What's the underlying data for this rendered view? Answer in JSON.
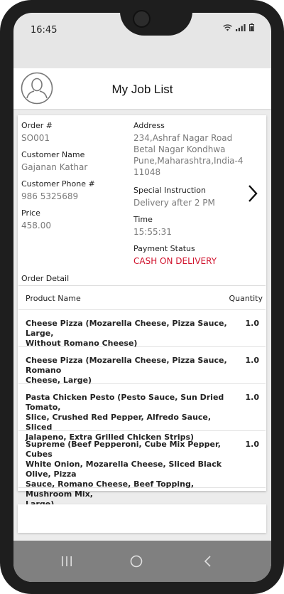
{
  "status_bar": {
    "time": "16:45",
    "icons": [
      "wifi-icon",
      "signal-icon",
      "battery-icon"
    ]
  },
  "header": {
    "title": "My Job List",
    "avatar_icon": "user-avatar-icon"
  },
  "order": {
    "order_no_label": "Order #",
    "order_no": "SO001",
    "customer_name_label": "Customer Name",
    "customer_name": "Gajanan Kathar",
    "customer_phone_label": "Customer Phone #",
    "customer_phone": "986 5325689",
    "price_label": "Price",
    "price": "458.00",
    "address_label": "Address",
    "address_lines": [
      "234,Ashraf Nagar Road",
      "Betal Nagar Kondhwa",
      "Pune,Maharashtra,India-4",
      "11048"
    ],
    "special_instruction_label": "Special Instruction",
    "special_instruction": "Delivery after 2 PM",
    "time_label": "Time",
    "time": "15:55:31",
    "payment_status_label": "Payment Status",
    "payment_status": "CASH ON DELIVERY",
    "payment_status_color": "#d0122c"
  },
  "order_detail": {
    "label": "Order Detail",
    "columns": {
      "name": "Product Name",
      "quantity": "Quantity"
    },
    "rows": [
      {
        "lines": [
          "Cheese Pizza (Mozarella Cheese, Pizza Sauce, Large,",
          "Without Romano Cheese)"
        ],
        "qty": "1.0"
      },
      {
        "lines": [
          "Cheese Pizza (Mozarella Cheese, Pizza Sauce, Romano",
          "Cheese, Large)"
        ],
        "qty": "1.0"
      },
      {
        "lines": [
          "Pasta Chicken Pesto (Pesto Sauce, Sun Dried Tomato,",
          "Slice, Crushed Red Pepper, Alfredo Sauce, Sliced",
          "Jalapeno, Extra Grilled Chicken Strips)"
        ],
        "qty": "1.0"
      },
      {
        "lines": [
          "Supreme (Beef Pepperoni, Cube Mix Pepper, Cubes",
          "White Onion, Mozarella Cheese, Sliced Black Olive, Pizza",
          "Sauce, Romano Cheese, Beef Topping, Mushroom Mix,",
          "Large)"
        ],
        "qty": "1.0"
      }
    ]
  },
  "navbar": {
    "icons": [
      "recent-apps-icon",
      "home-icon",
      "back-icon"
    ]
  }
}
